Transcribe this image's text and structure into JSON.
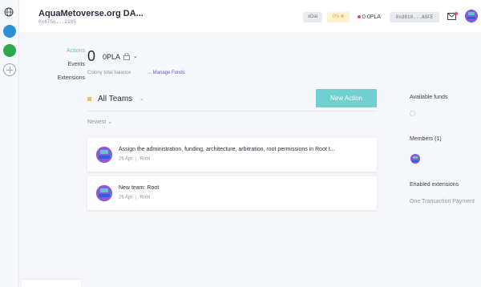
{
  "header": {
    "colony_name": "AquaMetoverse.org DA...",
    "colony_address": "0x675b...2295",
    "network": "xDai",
    "percent_badge": "0%",
    "token_balance": "0 0PLA",
    "wallet_address": "0xd810...A9FE",
    "icons": [
      "globe-icon",
      "inbox-icon",
      "user-avatar"
    ]
  },
  "nav": {
    "items": [
      {
        "label": "Actions",
        "active": true
      },
      {
        "label": "Events",
        "active": false
      },
      {
        "label": "Extensions",
        "active": false
      }
    ]
  },
  "funds": {
    "amount": "0",
    "symbol": "0PLA",
    "label": "Colony total balance",
    "manage_link": "→ Manage Funds"
  },
  "teams": {
    "selected": "All Teams",
    "new_action": "New Action",
    "sort": "Newest ⌄"
  },
  "feed": [
    {
      "title": "Assign the administration, funding, architecture, arbitration, root permissions in Root t...",
      "date": "26 Apr",
      "team": "Root"
    },
    {
      "title": "New team: Root",
      "date": "26 Apr",
      "team": "Root"
    }
  ],
  "sidebar": {
    "available_funds": "Available funds",
    "members": "Members (1)",
    "enabled_extensions": "Enabled extensions",
    "extension_name": "One Transaction Payment"
  },
  "colors": {
    "accent": "#6fd0cf",
    "link": "#4a63d4",
    "team_bullet": "#f5c24b",
    "avatar": "#8c5ad8"
  }
}
